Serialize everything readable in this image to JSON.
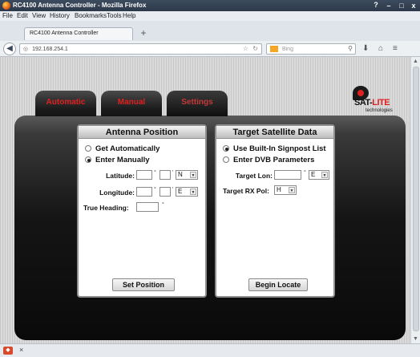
{
  "window": {
    "title": "RC4100 Antenna Controller - Mozilla Firefox",
    "help": "?",
    "minimize": "–",
    "maximize": "□",
    "close": "x"
  },
  "menu": [
    "File",
    "Edit",
    "View",
    "History",
    "Bookmarks",
    "Tools",
    "Help"
  ],
  "browser_tab": {
    "label": "RC4100 Antenna Controller",
    "new_tab": "+"
  },
  "nav": {
    "url": "192.168.254.1",
    "search_placeholder": "Bing"
  },
  "app": {
    "tabs": [
      {
        "label": "Automatic"
      },
      {
        "label": "Manual"
      },
      {
        "label": "Settings",
        "active": true
      }
    ],
    "logo": {
      "brand_part1": "SAT-",
      "brand_part2": "LITE",
      "subtitle": "technologies"
    },
    "antenna": {
      "title": "Antenna Position",
      "options": [
        {
          "label": "Get Automatically",
          "checked": false
        },
        {
          "label": "Enter Manually",
          "checked": true
        }
      ],
      "latitude_label": "Latitude:",
      "latitude_dir": "N",
      "longitude_label": "Longitude:",
      "longitude_dir": "E",
      "heading_label": "True Heading:",
      "degree_symbol": "°",
      "minute_symbol": "'",
      "button": "Set Position"
    },
    "target": {
      "title": "Target Satellite Data",
      "options": [
        {
          "label": "Use Built-In Signpost List",
          "checked": true
        },
        {
          "label": "Enter DVB Parameters",
          "checked": false
        }
      ],
      "lon_label": "Target Lon:",
      "lon_dir": "E",
      "pol_label": "Target RX Pol:",
      "pol_value": "H",
      "button": "Begin Locate"
    }
  },
  "statusbar": {
    "close": "×"
  }
}
